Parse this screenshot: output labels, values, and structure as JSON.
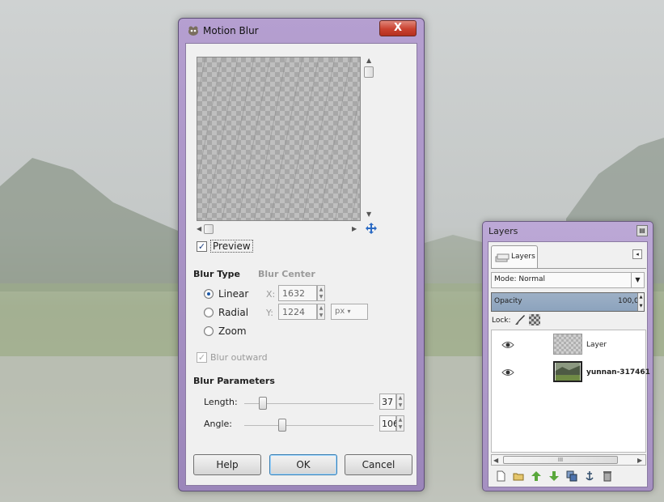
{
  "motion_blur": {
    "title": "Motion Blur",
    "close_label": "X",
    "preview_label": "Preview",
    "preview_checked": true,
    "blur_type_heading": "Blur Type",
    "blur_center_heading": "Blur Center",
    "blur_types": [
      "Linear",
      "Radial",
      "Zoom"
    ],
    "selected_blur_type": "Linear",
    "center_x_label": "X:",
    "center_x_value": "1632",
    "center_y_label": "Y:",
    "center_y_value": "1224",
    "unit": "px",
    "blur_outward_label": "Blur outward",
    "blur_outward_checked": true,
    "params_heading": "Blur Parameters",
    "length_label": "Length:",
    "length_value": "37",
    "angle_label": "Angle:",
    "angle_value": "106",
    "help_label": "Help",
    "ok_label": "OK",
    "cancel_label": "Cancel"
  },
  "layers": {
    "title": "Layers",
    "tab_label": "Layers",
    "mode_label": "Mode: Normal",
    "opacity_label": "Opacity",
    "opacity_value": "100,0",
    "lock_label": "Lock:",
    "items": [
      {
        "name": "Layer",
        "visible": true
      },
      {
        "name": "yunnan-317461",
        "visible": true
      }
    ],
    "scroll_label": "III"
  },
  "colors": {
    "title_bar": "#b59fd0",
    "close_button": "#c9412f",
    "default_button_border": "#3c7fb1"
  }
}
